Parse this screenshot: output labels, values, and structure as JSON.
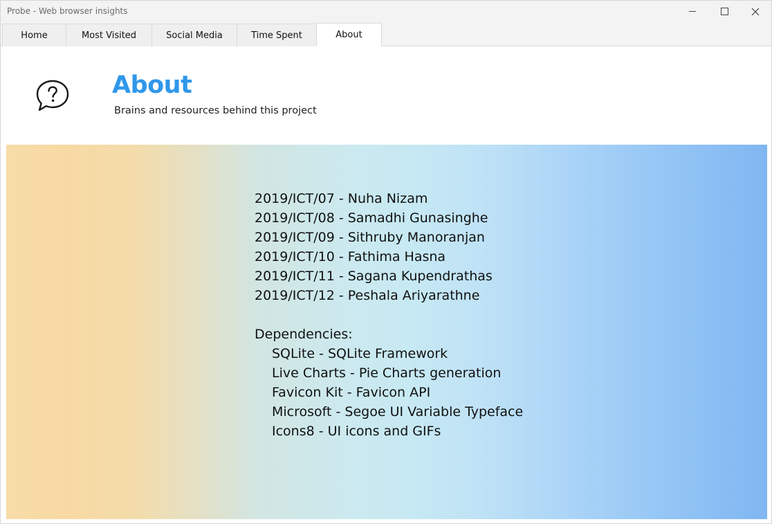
{
  "window": {
    "title": "Probe - Web browser insights"
  },
  "tabs": [
    {
      "label": "Home"
    },
    {
      "label": "Most Visited"
    },
    {
      "label": "Social Media"
    },
    {
      "label": "Time Spent"
    },
    {
      "label": "About"
    }
  ],
  "active_tab": "About",
  "header": {
    "title": "About",
    "subtitle": "Brains and resources behind this project",
    "icon": "help-speech-bubble-icon"
  },
  "team": [
    "2019/ICT/07 - Nuha Nizam",
    "2019/ICT/08 - Samadhi Gunasinghe",
    "2019/ICT/09 - Sithruby Manoranjan",
    "2019/ICT/10 - Fathima Hasna",
    "2019/ICT/11 - Sagana Kupendrathas",
    "2019/ICT/12 - Peshala Ariyarathne"
  ],
  "dependencies": {
    "heading": "Dependencies:",
    "items": [
      "SQLite - SQLite Framework",
      "Live Charts - Pie Charts generation",
      "Favicon Kit - Favicon API",
      "Microsoft - Segoe UI Variable Typeface",
      "Icons8 - UI icons and GIFs"
    ]
  },
  "colors": {
    "accent": "#2f97ea",
    "gradient_left": "#f7dca8",
    "gradient_right": "#80b6f2"
  }
}
